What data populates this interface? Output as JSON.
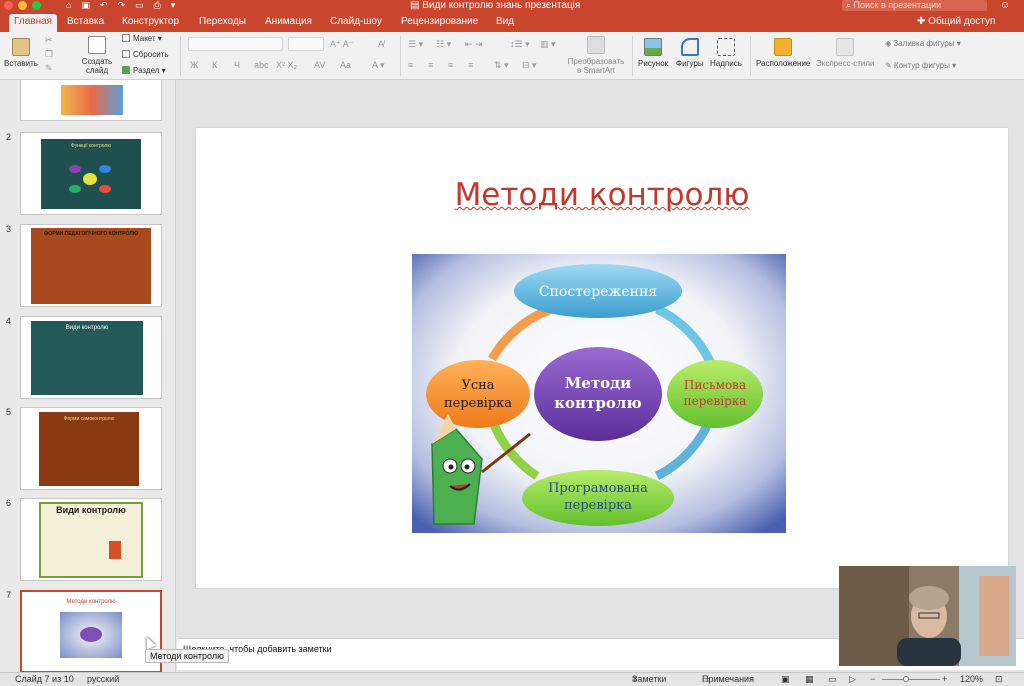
{
  "window": {
    "title": "Види контролю знань презентація",
    "search_placeholder": "Поиск в презентации",
    "accent": "#c9452e"
  },
  "tabs": [
    {
      "label": "Главная",
      "active": true
    },
    {
      "label": "Вставка"
    },
    {
      "label": "Конструктор"
    },
    {
      "label": "Переходы"
    },
    {
      "label": "Анимация"
    },
    {
      "label": "Слайд-шоу"
    },
    {
      "label": "Рецензирование"
    },
    {
      "label": "Вид"
    }
  ],
  "share_label": "Общий доступ",
  "ribbon": {
    "paste": "Вставить",
    "new_slide": "Создать слайд",
    "layout": "Макет",
    "reset": "Сбросить",
    "section": "Раздел",
    "convert_smartart": "Преобразовать в SmartArt",
    "picture": "Рисунок",
    "shapes": "Фигуры",
    "textbox": "Надпись",
    "arrange": "Расположение",
    "quick_styles": "Экспресс-стили",
    "shape_fill": "Заливка фигуры",
    "shape_outline": "Контур фигуры"
  },
  "slides": [
    {
      "num": "2",
      "title": "Функції контролю"
    },
    {
      "num": "3",
      "title": "ФОРМИ ПЕДАГОГІЧНОГО КОНТРОЛЮ"
    },
    {
      "num": "4",
      "title": "Види контролю"
    },
    {
      "num": "5",
      "title": "Форми самоконтролю"
    },
    {
      "num": "6",
      "title": "Види контролю"
    },
    {
      "num": "7",
      "title": "Методи контролю"
    }
  ],
  "current_slide": {
    "title": "Методи контролю",
    "center": "Методи контролю",
    "nodes": {
      "top": "Спостереження",
      "left": "Усна перевірка",
      "right": "Письмова перевірка",
      "bottom": "Програмована перевірка"
    }
  },
  "notes_placeholder": "Щелкните, чтобы добавить заметки",
  "tooltip": "Методи контролю",
  "status": {
    "slide_counter": "Слайд 7 из 10",
    "language": "русский",
    "notes": "Заметки",
    "comments": "Примечания",
    "zoom": "120%"
  }
}
